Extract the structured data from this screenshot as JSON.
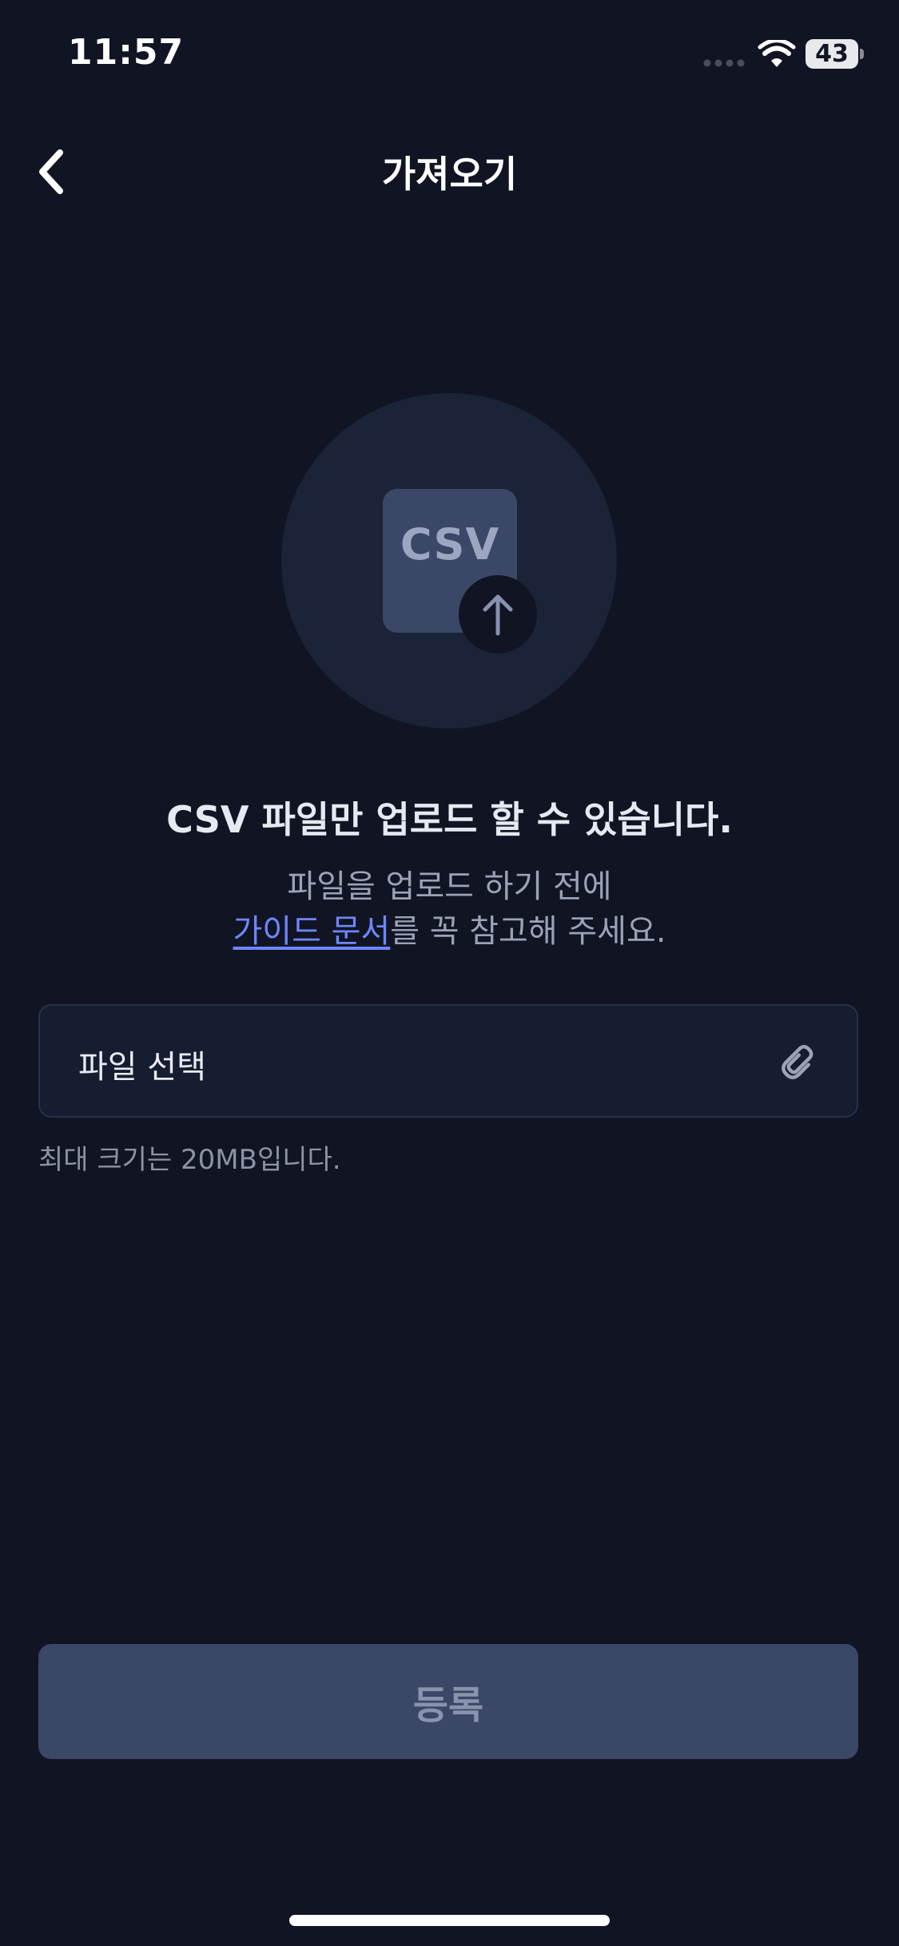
{
  "status_bar": {
    "time": "11:57",
    "battery_level": "43"
  },
  "header": {
    "title": "가져오기",
    "back_icon": "chevron-left-icon"
  },
  "illustration": {
    "file_label": "CSV",
    "badge_icon": "arrow-up-icon"
  },
  "content": {
    "headline": "CSV 파일만 업로드 할 수 있습니다.",
    "desc_line1": "파일을 업로드 하기 전에",
    "guide_link": "가이드 문서",
    "desc_line2_suffix": "를 꼭 참고해 주세요."
  },
  "file_select": {
    "label": "파일 선택",
    "icon": "paperclip-icon",
    "helper": "최대 크기는 20MB입니다."
  },
  "submit": {
    "label": "등록"
  },
  "colors": {
    "background": "#111423",
    "link": "#6f86ff",
    "button_disabled": "#3b4766"
  }
}
